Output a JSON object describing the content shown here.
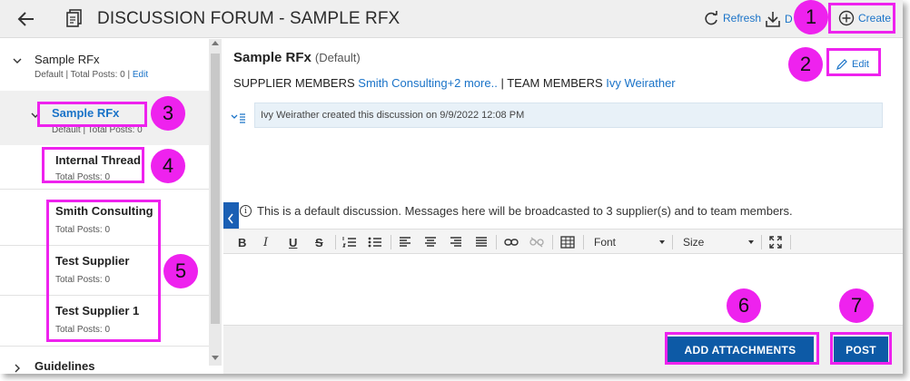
{
  "header": {
    "title": "DISCUSSION FORUM - SAMPLE RFX",
    "refresh_label": "Refresh",
    "download_label": "D",
    "create_label": "Create"
  },
  "tree": {
    "root": {
      "name": "Sample RFx",
      "meta": "Default  |  Total Posts: 0  |",
      "edit": "Edit"
    },
    "selected": {
      "name": "Sample RFx",
      "meta": "Default | Total Posts: 0"
    },
    "items": [
      {
        "name": "Internal Thread",
        "meta": "Total Posts: 0"
      },
      {
        "name": "Smith Consulting",
        "meta": "Total Posts: 0"
      },
      {
        "name": "Test Supplier",
        "meta": "Total Posts: 0"
      },
      {
        "name": "Test Supplier 1",
        "meta": "Total Posts: 0"
      }
    ],
    "guidelines": "Guidelines"
  },
  "discussion": {
    "title": "Sample RFx",
    "default_tag": "(Default)",
    "edit_label": "Edit",
    "supplier_label": "SUPPLIER MEMBERS",
    "supplier_link": "Smith Consulting+2 more..",
    "team_label": "| TEAM MEMBERS",
    "team_link": "Ivy Weirather",
    "activity": "Ivy Weirather created this discussion on 9/9/2022 12:08 PM",
    "info": "This is a default discussion. Messages here will be broadcasted to 3 supplier(s) and to team members."
  },
  "toolbar": {
    "bold": "B",
    "italic": "I",
    "underline": "U",
    "strike": "S",
    "font_label": "Font",
    "size_label": "Size"
  },
  "footer": {
    "attach_label": "ADD ATTACHMENTS",
    "post_label": "POST"
  },
  "callouts": [
    "1",
    "2",
    "3",
    "4",
    "5",
    "6",
    "7"
  ],
  "colors": {
    "accent": "#1a73c8",
    "primary_button": "#0d5aa6",
    "callout": "#ee22ee"
  }
}
